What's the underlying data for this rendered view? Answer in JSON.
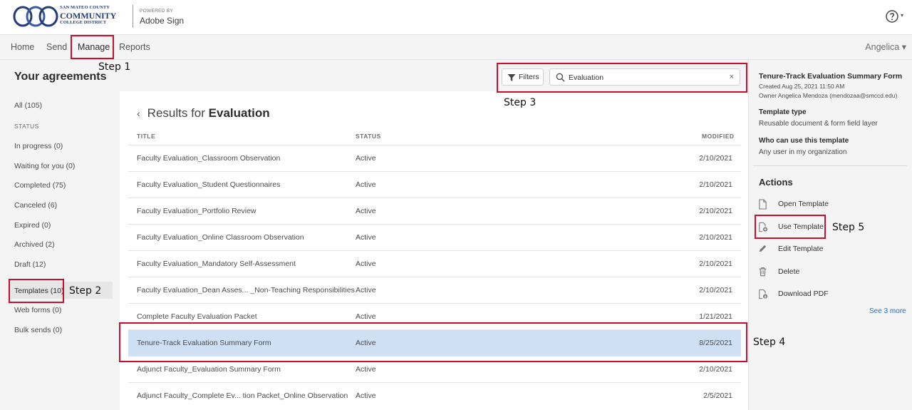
{
  "brand": {
    "logo_line1": "SAN MATEO COUNTY",
    "logo_line2": "COMMUNITY",
    "logo_line3": "COLLEGE DISTRICT",
    "powered_by": "POWERED BY",
    "product": "Adobe Sign",
    "logo_color": "#243c7a"
  },
  "nav": {
    "items": [
      "Home",
      "Send",
      "Manage",
      "Reports"
    ],
    "active": "Manage",
    "user": "Angelica ▾"
  },
  "page": {
    "title": "Your agreements"
  },
  "sidebar": {
    "all": "All (105)",
    "status_heading": "STATUS",
    "status_items": [
      "In progress (0)",
      "Waiting for you (0)",
      "Completed (75)",
      "Canceled (6)",
      "Expired (0)",
      "Archived (2)",
      "Draft (12)"
    ],
    "type_items": [
      "Templates (10)",
      "Web forms (0)",
      "Bulk sends (0)"
    ],
    "selected": "Templates (10)"
  },
  "toolbar": {
    "filters_label": "Filters",
    "search_value": "Evaluation",
    "clear_label": "×"
  },
  "results": {
    "prefix": "Results for",
    "query": "Evaluation",
    "columns": [
      "TITLE",
      "STATUS",
      "MODIFIED"
    ],
    "rows": [
      {
        "title": "Faculty Evaluation_Classroom Observation",
        "status": "Active",
        "modified": "2/10/2021"
      },
      {
        "title": "Faculty Evaluation_Student Questionnaires",
        "status": "Active",
        "modified": "2/10/2021"
      },
      {
        "title": "Faculty Evaluation_Portfolio Review",
        "status": "Active",
        "modified": "2/10/2021"
      },
      {
        "title": "Faculty Evaluation_Online Classroom Observation",
        "status": "Active",
        "modified": "2/10/2021"
      },
      {
        "title": "Faculty Evaluation_Mandatory Self-Assessment",
        "status": "Active",
        "modified": "2/10/2021"
      },
      {
        "title": "Faculty Evaluation_Dean Asses... _Non-Teaching Responsibilities",
        "status": "Active",
        "modified": "2/10/2021"
      },
      {
        "title": "Complete Faculty Evaluation Packet",
        "status": "Active",
        "modified": "1/21/2021"
      },
      {
        "title": "Tenure-Track Evaluation Summary Form",
        "status": "Active",
        "modified": "8/25/2021"
      },
      {
        "title": "Adjunct Faculty_Evaluation Summary Form",
        "status": "Active",
        "modified": "2/10/2021"
      },
      {
        "title": "Adjunct Faculty_Complete Ev... tion Packet_Online Observation",
        "status": "Active",
        "modified": "2/5/2021"
      }
    ],
    "selected_index": 7
  },
  "details": {
    "title": "Tenure-Track Evaluation Summary Form",
    "created": "Created Aug 25, 2021 11:50 AM",
    "owner": "Owner Angelica Mendoza (mendozaa@smccd.edu)",
    "template_type_label": "Template type",
    "template_type_value": "Reusable document & form field layer",
    "who_label": "Who can use this template",
    "who_value": "Any user in my organization",
    "actions_heading": "Actions",
    "actions": [
      "Open Template",
      "Use Template",
      "Edit Template",
      "Delete",
      "Download PDF"
    ],
    "see_more": "See 3 more"
  },
  "annotations": {
    "steps": [
      "Step 1",
      "Step 2",
      "Step 3",
      "Step 4",
      "Step 5"
    ],
    "box_color": "#c8102e"
  }
}
